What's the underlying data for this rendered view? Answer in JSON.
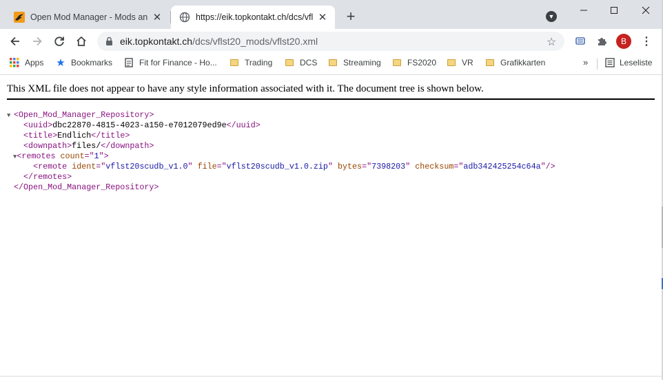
{
  "tabs": [
    {
      "title": "Open Mod Manager - Mods and",
      "favicon": "bird-logo-icon",
      "active": false
    },
    {
      "title": "https://eik.topkontakt.ch/dcs/vfls",
      "favicon": "globe-icon",
      "active": true
    }
  ],
  "address_bar": {
    "host": "eik.topkontakt.ch",
    "path": "/dcs/vflst20_mods/vflst20.xml"
  },
  "profile_initial": "B",
  "bookmarks": [
    {
      "label": "Apps",
      "icon": "apps-grid-icon"
    },
    {
      "label": "Bookmarks",
      "icon": "star-icon"
    },
    {
      "label": "Fit for Finance - Ho...",
      "icon": "page-icon"
    },
    {
      "label": "Trading",
      "icon": "folder-icon"
    },
    {
      "label": "DCS",
      "icon": "folder-icon"
    },
    {
      "label": "Streaming",
      "icon": "folder-icon"
    },
    {
      "label": "FS2020",
      "icon": "folder-icon"
    },
    {
      "label": "VR",
      "icon": "folder-icon"
    },
    {
      "label": "Grafikkarten",
      "icon": "folder-icon"
    }
  ],
  "reading_list_label": "Leseliste",
  "notice": "This XML file does not appear to have any style information associated with it. The document tree is shown below.",
  "xml": {
    "root_tag": "Open_Mod_Manager_Repository",
    "uuid_tag": "uuid",
    "uuid": "dbc22870-4815-4023-a150-e7012079ed9e",
    "title_tag": "title",
    "title": "Endlich",
    "downpath_tag": "downpath",
    "downpath": "files/",
    "remotes_tag": "remotes",
    "remotes_count_attr": "count",
    "remotes_count": "1",
    "remote_tag": "remote",
    "remote": {
      "ident_attr": "ident",
      "ident": "vflst20scudb_v1.0",
      "file_attr": "file",
      "file": "vflst20scudb_v1.0.zip",
      "bytes_attr": "bytes",
      "bytes": "7398203",
      "checksum_attr": "checksum",
      "checksum": "adb342425254c64a"
    }
  },
  "colors": {
    "tag": "#881280",
    "attribute_name": "#994500",
    "attribute_value": "#1a1aa6",
    "tabstrip": "#dee1e6",
    "avatar": "#c5221f"
  }
}
